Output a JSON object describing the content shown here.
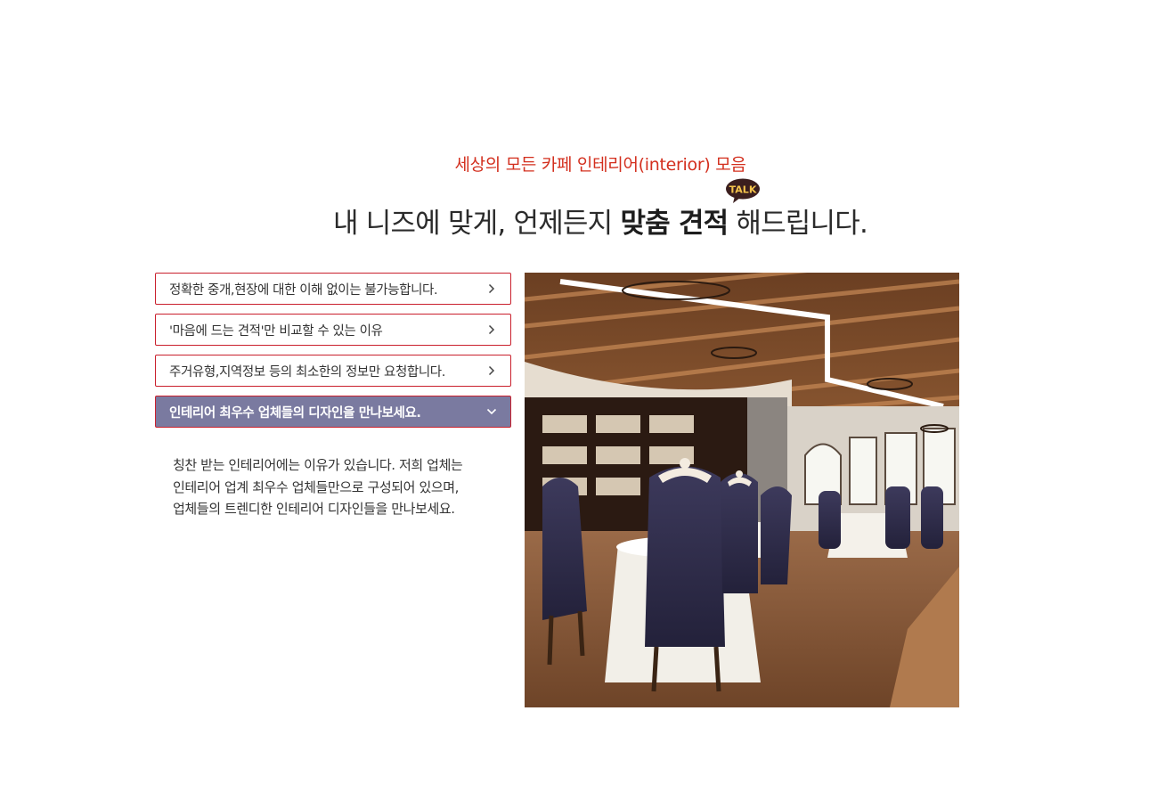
{
  "header": {
    "subtitle": "세상의 모든 카페 인테리어(interior) 모음",
    "headline_pre": "내 니즈에 맞게, 언제든지 ",
    "headline_bold": "맞춤 견적",
    "headline_post": " 해드립니다.",
    "talk_badge": "TALK"
  },
  "accordion": {
    "items": [
      {
        "label": "정확한 중개,현장에 대한 이해 없이는 불가능합니다.",
        "icon": "chevron-right-icon",
        "active": false
      },
      {
        "label": "'마음에 드는 견적'만 비교할 수 있는 이유",
        "icon": "chevron-right-icon",
        "active": false
      },
      {
        "label": "주거유형,지역정보 등의 최소한의 정보만 요청합니다.",
        "icon": "chevron-right-icon",
        "active": false
      },
      {
        "label": "인테리어 최우수 업체들의 디자인을 만나보세요.",
        "icon": "chevron-down-icon",
        "active": true
      }
    ],
    "active_body": [
      "칭찬 받는 인테리어에는 이유가 있습니다. 저희 업체는",
      "인테리어 업계 최우수 업체들만으로 구성되어 있으며,",
      "업체들의 트렌디한 인테리어 디자인들을 만나보세요."
    ]
  },
  "colors": {
    "accent_red": "#c9202d",
    "subtitle_red": "#d32f1e",
    "active_bg": "#7a7aa0",
    "talk_bubble": "#3b1e1e"
  }
}
